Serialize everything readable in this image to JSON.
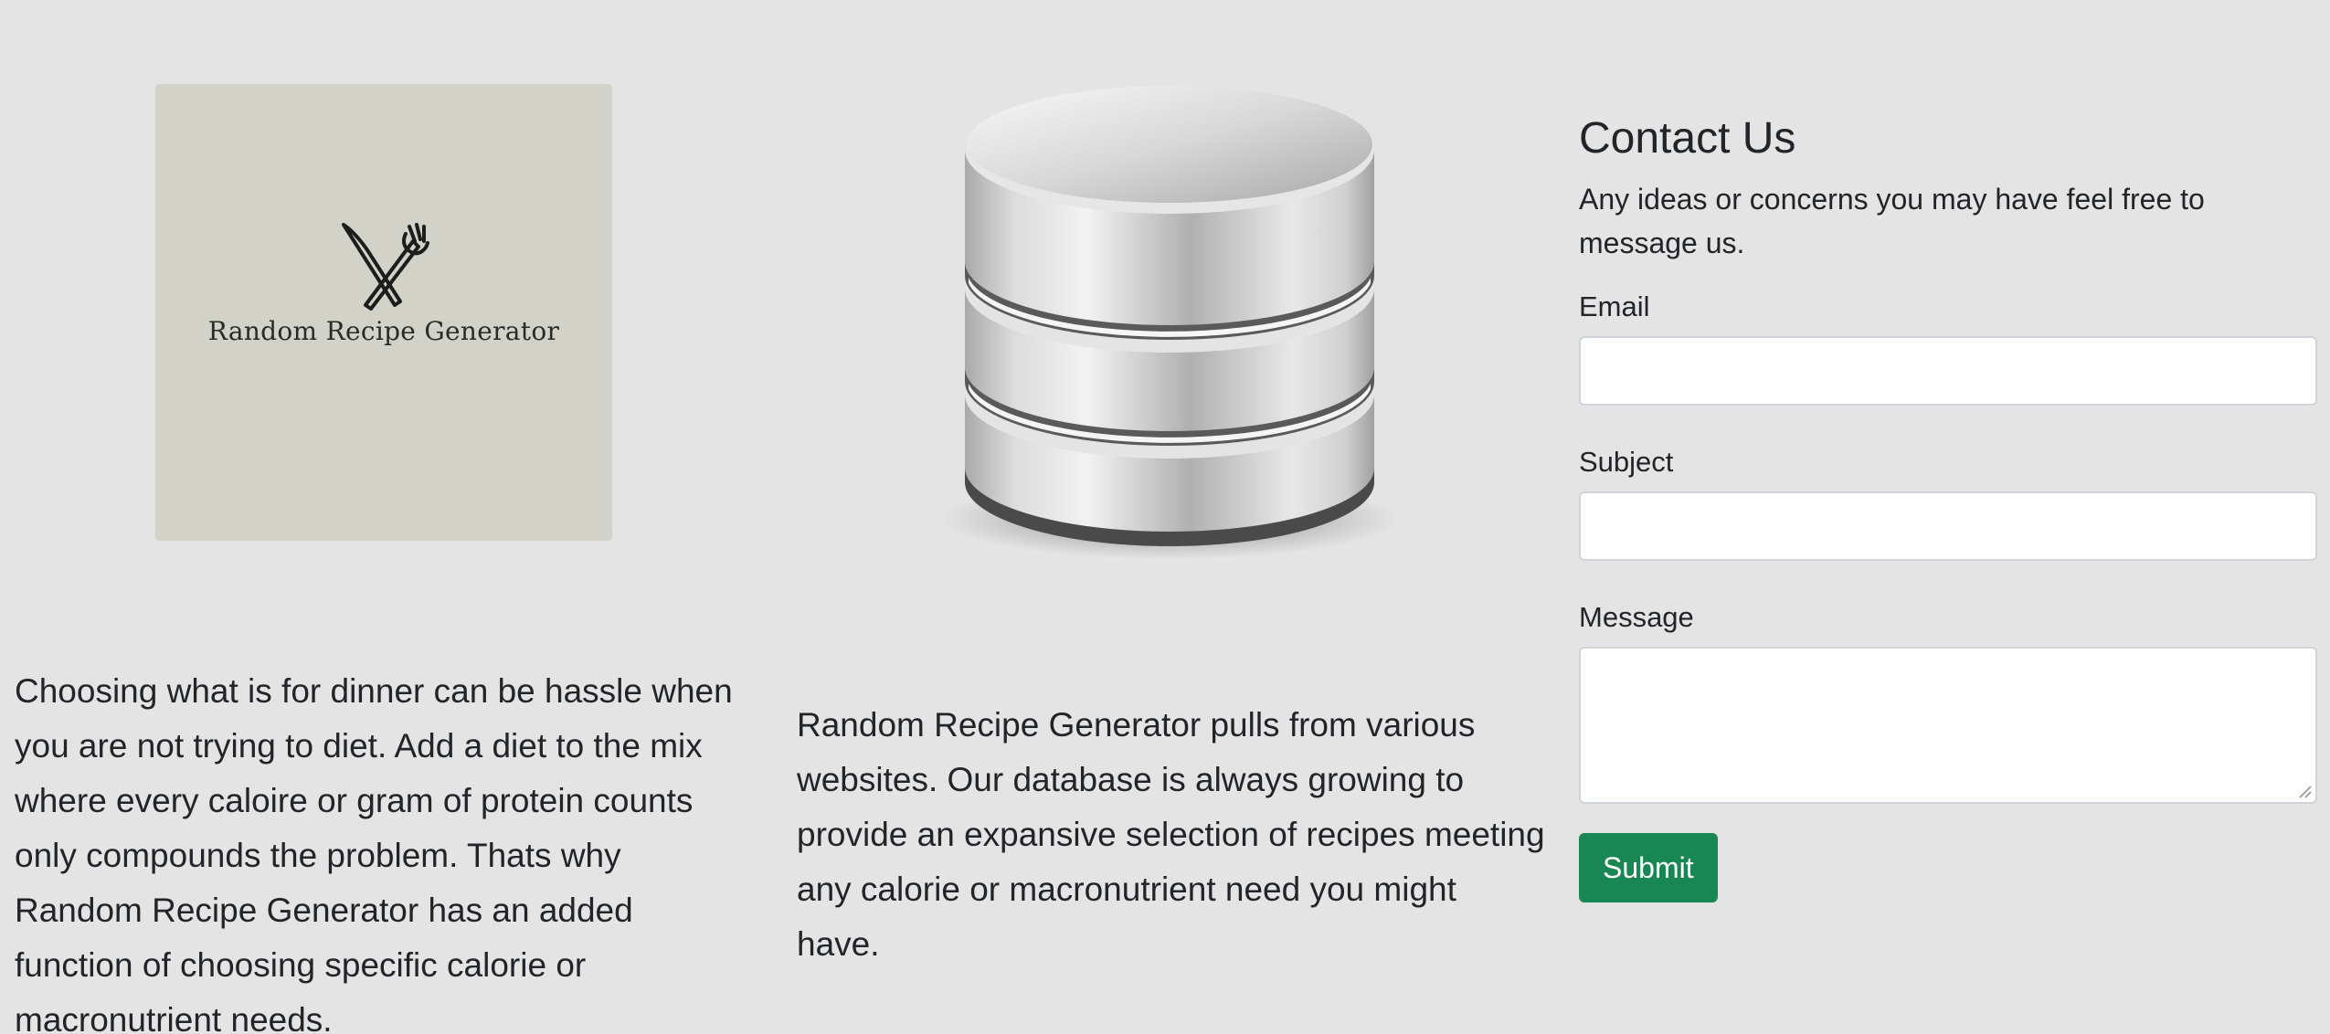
{
  "about": {
    "logo_text": "Random Recipe Generator",
    "logo_icon": "fork-knife-icon",
    "description": "Choosing what is for dinner can be hassle when you are not trying to diet. Add a diet to the mix where every caloire or gram of protein counts only compounds the problem. Thats why Random Recipe Generator has an added function of choosing specific calorie or macronutrient needs."
  },
  "database": {
    "icon": "database-icon",
    "description": "Random Recipe Generator pulls from various websites. Our database is always growing to provide an expansive selection of recipes meeting any calorie or macronutrient need you might have."
  },
  "contact": {
    "title": "Contact Us",
    "subtitle": "Any ideas or concerns you may have feel free to message us.",
    "email_label": "Email",
    "email_value": "",
    "subject_label": "Subject",
    "subject_value": "",
    "message_label": "Message",
    "message_value": "",
    "submit_label": "Submit"
  },
  "colors": {
    "background": "#e4e4e4",
    "logo_background": "#d2d2c8",
    "submit_button": "#198754"
  }
}
